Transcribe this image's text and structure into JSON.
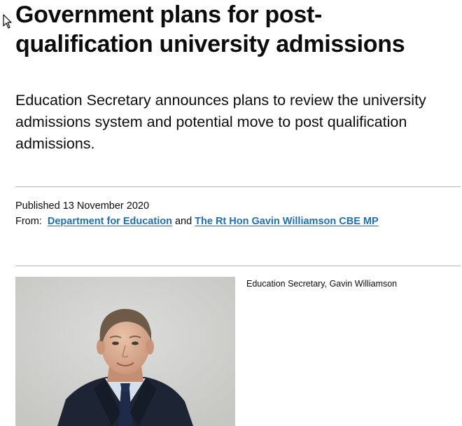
{
  "article": {
    "title": "Government plans for post-qualification university admissions",
    "summary": "Education Secretary announces plans to review the university admissions system and potential move to post qualification admissions.",
    "published_label": "Published",
    "published_date": "13 November 2020",
    "from_label": "From:",
    "organisations": [
      "Department for Education",
      "The Rt Hon Gavin Williamson CBE MP"
    ],
    "org_conjunction": "and",
    "image": {
      "caption": "Education Secretary, Gavin Williamson"
    }
  },
  "colors": {
    "link": "#1d70b8",
    "text": "#0b0c0c",
    "divider": "#b1b4b6"
  }
}
